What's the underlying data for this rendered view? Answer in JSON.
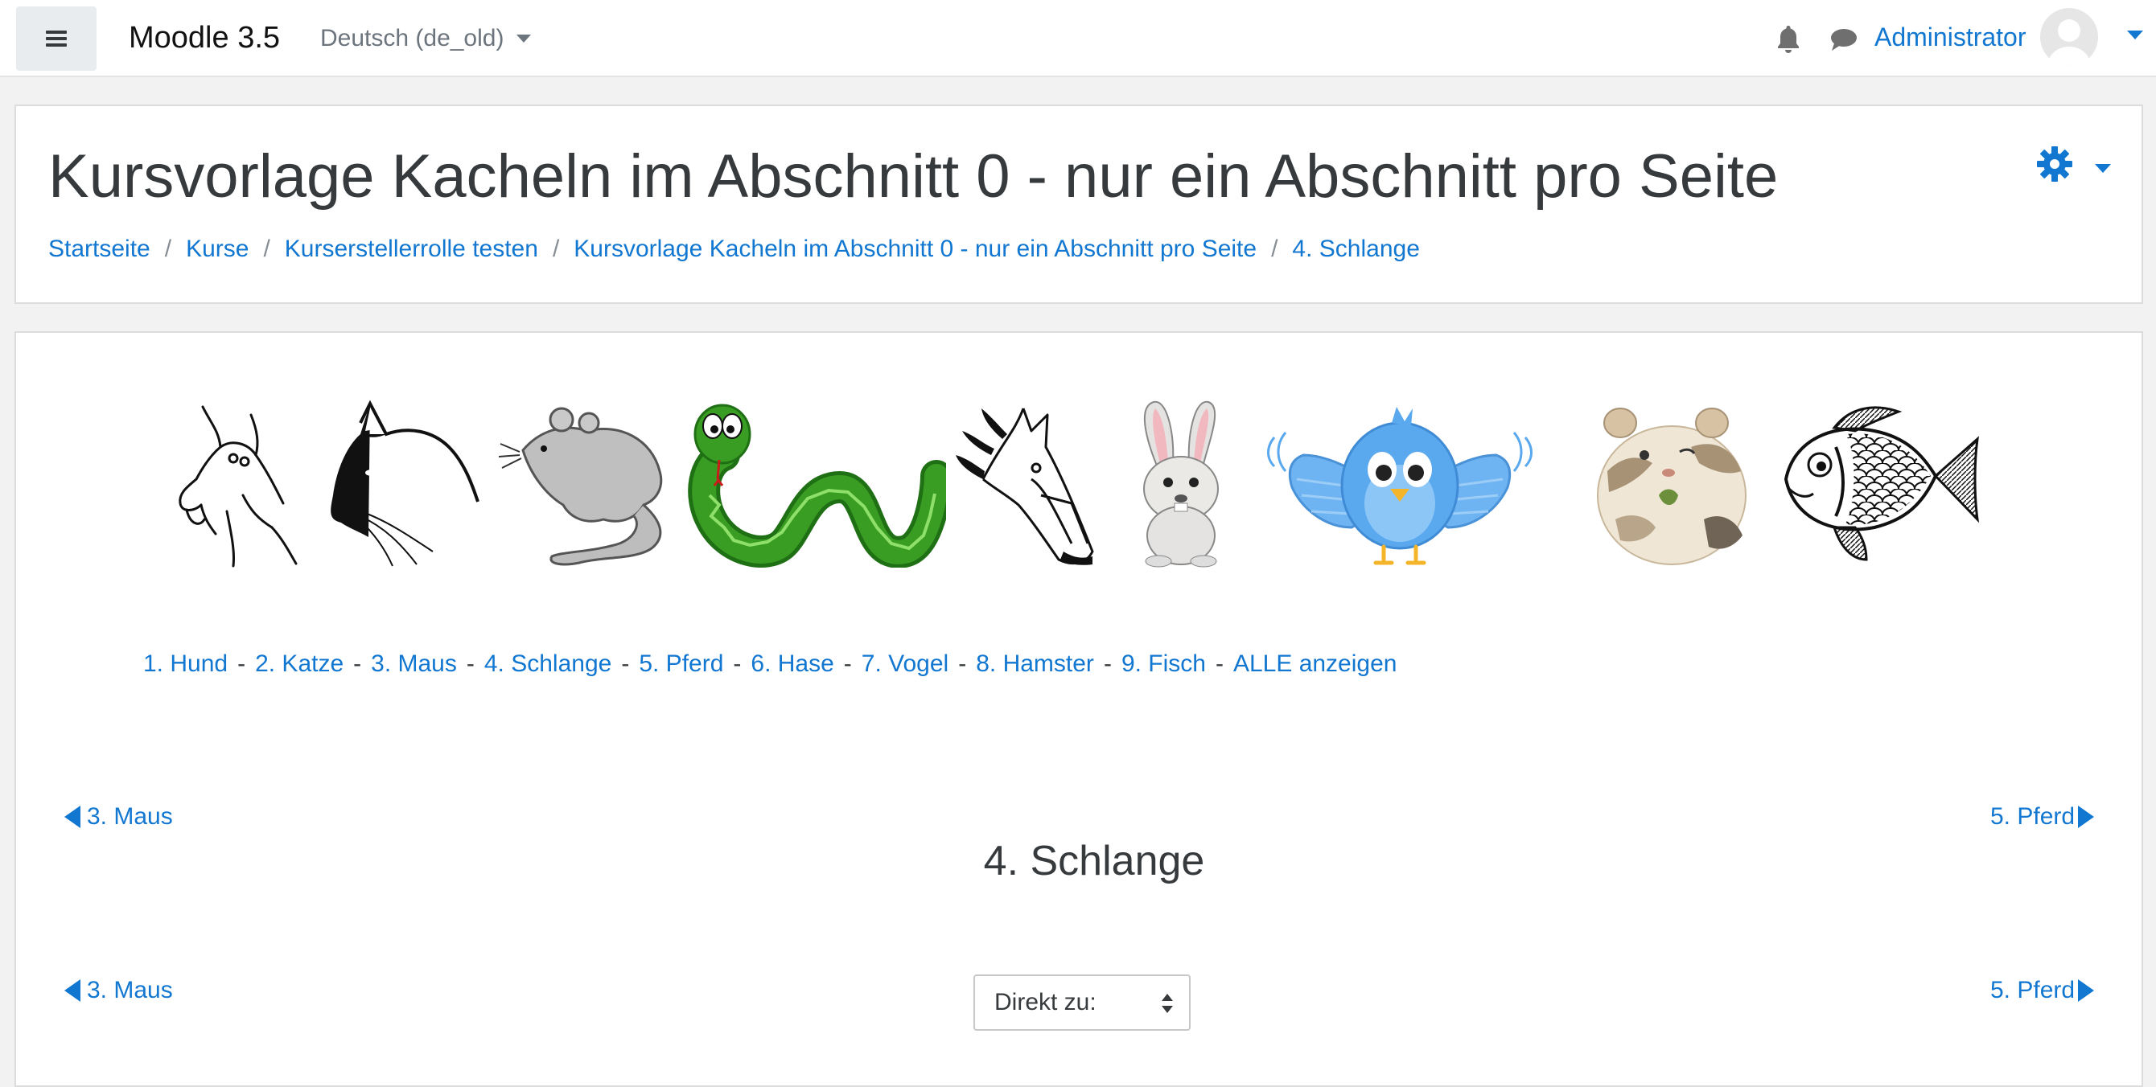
{
  "navbar": {
    "site_name": "Moodle 3.5",
    "language": "Deutsch (de_old)",
    "user_name": "Administrator"
  },
  "header": {
    "title": "Kursvorlage Kacheln im Abschnitt 0 - nur ein Abschnitt pro Seite",
    "breadcrumb": [
      "Startseite",
      "Kurse",
      "Kurserstellerrolle testen",
      "Kursvorlage Kacheln im Abschnitt 0 - nur ein Abschnitt pro Seite",
      "4. Schlange"
    ],
    "breadcrumb_separator": "/"
  },
  "tiles": [
    {
      "name": "Hund",
      "icon": "dog-image"
    },
    {
      "name": "Katze",
      "icon": "cat-image"
    },
    {
      "name": "Maus",
      "icon": "mouse-image"
    },
    {
      "name": "Schlange",
      "icon": "snake-image"
    },
    {
      "name": "Pferd",
      "icon": "horse-image"
    },
    {
      "name": "Hase",
      "icon": "rabbit-image"
    },
    {
      "name": "Vogel",
      "icon": "bird-image"
    },
    {
      "name": "Hamster",
      "icon": "hamster-image"
    },
    {
      "name": "Fisch",
      "icon": "fish-image"
    }
  ],
  "section_links": [
    "1. Hund",
    "2. Katze",
    "3. Maus",
    "4. Schlange",
    "5. Pferd",
    "6. Hase",
    "7. Vogel",
    "8. Hamster",
    "9. Fisch",
    "ALLE anzeigen"
  ],
  "section_links_separator": "-",
  "section": {
    "title": "4. Schlange",
    "prev": "3. Maus",
    "next": "5. Pferd",
    "jump_label": "Direkt zu:"
  },
  "colors": {
    "link": "#1177d1",
    "text": "#373a3c",
    "snake": "#3a9d23",
    "bird": "#5aa9ee"
  }
}
